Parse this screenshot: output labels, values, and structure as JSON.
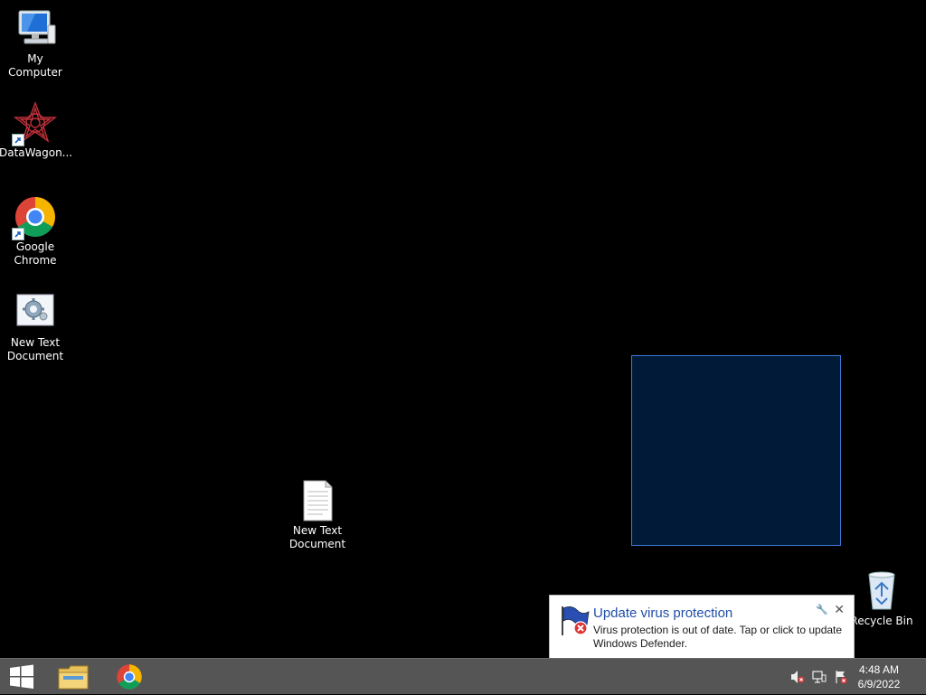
{
  "desktop": {
    "icons": [
      {
        "label": "My Computer",
        "icon": "computer-icon"
      },
      {
        "label": "DataWagon...",
        "icon": "datawagon-icon"
      },
      {
        "label": "Google\nChrome",
        "icon": "chrome-icon"
      },
      {
        "label": "New Text\nDocument",
        "icon": "gear-document-icon"
      },
      {
        "label": "New Text\nDocument",
        "icon": "text-document-icon"
      },
      {
        "label": "Recycle Bin",
        "icon": "recycle-bin-icon"
      }
    ]
  },
  "notification": {
    "title": "Update virus protection",
    "body": "Virus protection is out of date. Tap or click to update Windows Defender.",
    "close_glyph": "✕",
    "settings_glyph": "🔧"
  },
  "taskbar": {
    "pinned": [
      {
        "name": "start-button",
        "icon": "windows-logo-icon"
      },
      {
        "name": "file-explorer",
        "icon": "folder-icon"
      },
      {
        "name": "google-chrome",
        "icon": "chrome-icon"
      }
    ],
    "tray": {
      "time": "4:48 AM",
      "date": "6/9/2022",
      "icons": [
        "volume-muted-icon",
        "network-icon",
        "action-center-icon"
      ]
    }
  },
  "colors": {
    "desktop_bg": "#000000",
    "taskbar_bg": "#555555",
    "selection_fill": "#001a38",
    "selection_border": "#3b78d6",
    "toast_title": "#1f4fa8"
  }
}
